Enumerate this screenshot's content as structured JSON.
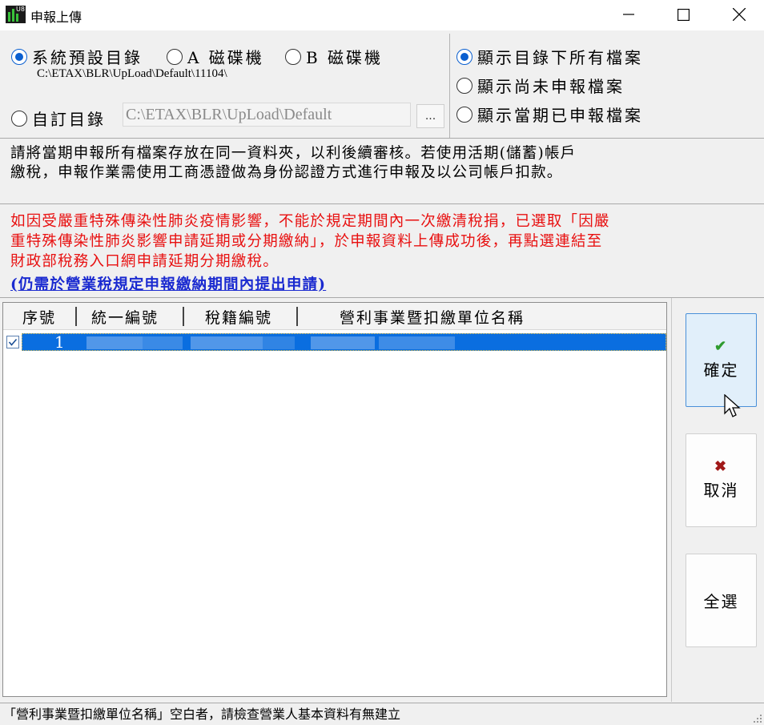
{
  "window": {
    "title": "申報上傳",
    "app_icon_tag": "U8",
    "controls": {
      "minimize": "minimize",
      "maximize": "maximize",
      "close": "close"
    }
  },
  "directory": {
    "options": [
      {
        "label": "系統預設目錄",
        "checked": true
      },
      {
        "label": "A 磁碟機",
        "checked": false
      },
      {
        "label": "B 磁碟機",
        "checked": false
      }
    ],
    "default_path": "C:\\ETAX\\BLR\\UpLoad\\Default\\11104\\",
    "custom_label": "自訂目錄",
    "custom_checked": false,
    "custom_path_value": "C:\\ETAX\\BLR\\UpLoad\\Default",
    "browse_label": "..."
  },
  "display_filter": {
    "options": [
      {
        "label": "顯示目錄下所有檔案",
        "checked": true
      },
      {
        "label": "顯示尚未申報檔案",
        "checked": false
      },
      {
        "label": "顯示當期已申報檔案",
        "checked": false
      }
    ]
  },
  "info": {
    "line1": "請將當期申報所有檔案存放在同一資料夾，以利後續審核。若使用活期(儲蓄)帳戶",
    "line2": "繳稅，申報作業需使用工商憑證做為身份認證方式進行申報及以公司帳戶扣款。"
  },
  "warning": {
    "line1": "如因受嚴重特殊傳染性肺炎疫情影響，不能於規定期間內一次繳清稅捐，已選取「因嚴",
    "line2": "重特殊傳染性肺炎影響申請延期或分期繳納」，於申報資料上傳成功後，再點選連結至",
    "line3": "財政部稅務入口網申請延期分期繳稅。",
    "link": "(仍需於營業稅規定申報繳納期間內提出申請)"
  },
  "table": {
    "columns": [
      "序號",
      "統一編號",
      "稅籍編號",
      "營利事業暨扣繳單位名稱"
    ],
    "rows": [
      {
        "seq": "1",
        "checked": true,
        "selected": true
      }
    ]
  },
  "buttons": {
    "confirm": {
      "label": "確定",
      "icon": "check-icon",
      "icon_glyph": "✔",
      "icon_color": "#2e9b2e"
    },
    "cancel": {
      "label": "取消",
      "icon": "x-icon",
      "icon_glyph": "✖",
      "icon_color": "#a01818"
    },
    "select_all": {
      "label": "全選"
    }
  },
  "status": {
    "text": "「營利事業暨扣繳單位名稱」空白者，請檢查營業人基本資料有無建立"
  }
}
